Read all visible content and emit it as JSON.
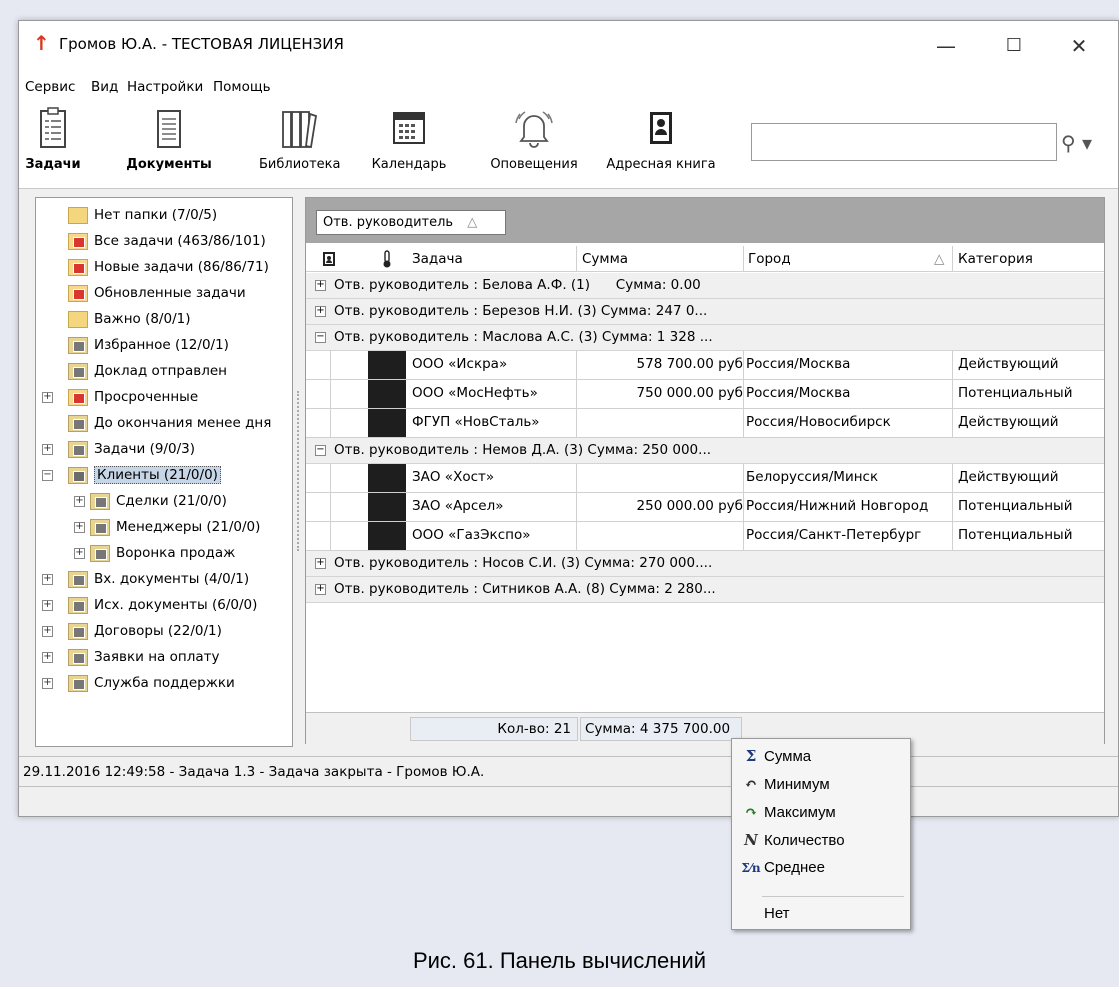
{
  "window": {
    "icon": "↑",
    "title": "Громов Ю.А. - ТЕСТОВАЯ ЛИЦЕНЗИЯ",
    "min": "—",
    "max": "☐",
    "close": "✕"
  },
  "menu": [
    "Сервис",
    "Вид",
    "Настройки",
    "Помощь"
  ],
  "toolbar": {
    "items": [
      {
        "label": "Задачи",
        "icon": "tasks-icon"
      },
      {
        "label": "Документы",
        "icon": "documents-icon"
      },
      {
        "label": "Библиотека",
        "icon": "library-icon"
      },
      {
        "label": "Календарь",
        "icon": "calendar-icon"
      },
      {
        "label": "Оповещения",
        "icon": "bell-icon"
      },
      {
        "label": "Адресная книга",
        "icon": "address-book-icon"
      }
    ],
    "search_value": ""
  },
  "tree": [
    {
      "label": "Нет папки (7/0/5)",
      "icon": "folder-icon"
    },
    {
      "label": "Все задачи (463/86/101)",
      "icon": "folder-red-icon"
    },
    {
      "label": "Новые задачи (86/86/71)",
      "icon": "folder-red-icon"
    },
    {
      "label": "Обновленные задачи",
      "icon": "folder-red-icon"
    },
    {
      "label": "Важно (8/0/1)",
      "icon": "folder-icon"
    },
    {
      "label": "Избранное (12/0/1)",
      "icon": "folder-gray-icon"
    },
    {
      "label": "Доклад отправлен",
      "icon": "folder-gray-icon"
    },
    {
      "label": "Просроченные",
      "icon": "folder-red-icon"
    },
    {
      "label": "До окончания менее дня",
      "icon": "folder-gray-icon"
    },
    {
      "label": "Задачи (9/0/3)",
      "icon": "folder-gray-icon"
    },
    {
      "label": "Клиенты (21/0/0)",
      "icon": "folder-gray-icon"
    },
    {
      "label": "Сделки (21/0/0)",
      "icon": "folder-gray-icon"
    },
    {
      "label": "Менеджеры (21/0/0)",
      "icon": "folder-gray-icon"
    },
    {
      "label": "Воронка продаж",
      "icon": "folder-gray-icon"
    },
    {
      "label": "Вх. документы (4/0/1)",
      "icon": "folder-gray-icon"
    },
    {
      "label": "Исх. документы (6/0/0)",
      "icon": "folder-gray-icon"
    },
    {
      "label": "Договоры (22/0/1)",
      "icon": "folder-gray-icon"
    },
    {
      "label": "Заявки на оплату",
      "icon": "folder-gray-icon"
    },
    {
      "label": "Служба поддержки",
      "icon": "folder-gray-icon"
    }
  ],
  "grid": {
    "group_tag": "Отв. руководитель",
    "group_tag_sort": "△",
    "columns": [
      "Задача",
      "Сумма",
      "Город",
      "Категория"
    ],
    "city_sort": "△",
    "groups": [
      {
        "text": "Отв. руководитель : Белова А.Ф. (1)      Сумма: 0.00",
        "exp": "+"
      },
      {
        "text": "Отв. руководитель : Березов Н.И. (3) Сумма: 247 0...",
        "exp": "+"
      },
      {
        "text": "Отв. руководитель : Маслова А.С. (3) Сумма: 1 328 ...",
        "exp": "−"
      },
      {
        "text": "Отв. руководитель : Немов Д.А. (3) Сумма: 250 000...",
        "exp": "−"
      },
      {
        "text": "Отв. руководитель : Носов С.И. (3) Сумма: 270 000....",
        "exp": "+"
      },
      {
        "text": "Отв. руководитель : Ситников А.А. (8) Сумма: 2 280...",
        "exp": "+"
      }
    ],
    "rows": [
      {
        "task": "ООО «Искра»",
        "sum": "578 700.00 руб",
        "city": "Россия/Москва",
        "cat": "Действующий"
      },
      {
        "task": "ООО «МосНефть»",
        "sum": "750 000.00 руб",
        "city": "Россия/Москва",
        "cat": "Потенциальный"
      },
      {
        "task": "ФГУП «НовСталь»",
        "sum": "",
        "city": "Россия/Новосибирск",
        "cat": "Действующий"
      },
      {
        "task": "ЗАО «Хост»",
        "sum": "",
        "city": "Белоруссия/Минск",
        "cat": "Действующий"
      },
      {
        "task": "ЗАО «Арсел»",
        "sum": "250 000.00 руб",
        "city": "Россия/Нижний Новгород",
        "cat": "Потенциальный"
      },
      {
        "task": "ООО «ГазЭкспо»",
        "sum": "",
        "city": "Россия/Санкт-Петербург",
        "cat": "Потенциальный"
      }
    ],
    "footer_count": "Кол-во: 21",
    "footer_sum": "Сумма: 4 375 700.00"
  },
  "status_text": "29.11.2016 12:49:58 - Задача 1.3 - Задача закрыта - Громов Ю.А.",
  "context_menu": [
    {
      "label": "Сумма",
      "glyph": "Σ",
      "icon": "sum-icon"
    },
    {
      "label": "Минимум",
      "glyph": "↶",
      "icon": "minimum-icon"
    },
    {
      "label": "Максимум",
      "glyph": "↷",
      "icon": "maximum-icon"
    },
    {
      "label": "Количество",
      "glyph": "N",
      "icon": "count-icon"
    },
    {
      "label": "Среднее",
      "glyph": "Σ⁄n",
      "icon": "average-icon"
    },
    {
      "label": "Нет",
      "glyph": "",
      "icon": ""
    }
  ],
  "caption": "Рис. 61. Панель вычислений"
}
